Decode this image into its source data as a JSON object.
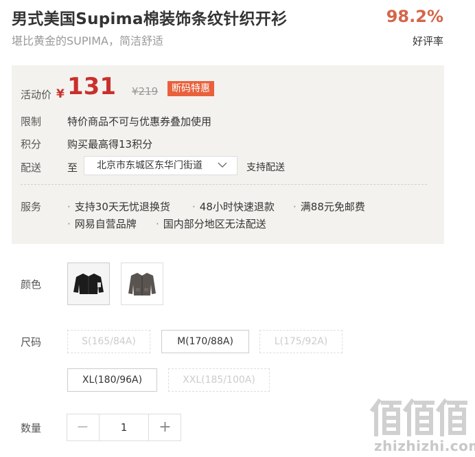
{
  "product": {
    "title": "男式美国Supima棉装饰条纹针织开衫",
    "subtitle": "堪比黄金的SUPIMA，简洁舒适",
    "rating_value": "98.2%",
    "rating_label": "好评率"
  },
  "price_panel": {
    "activity_label": "活动价",
    "currency": "¥",
    "price": "131",
    "original_price": "¥219",
    "badge": "断码特惠",
    "limit_label": "限制",
    "limit_text": "特价商品不可与优惠券叠加使用",
    "points_label": "积分",
    "points_text": "购买最高得13积分",
    "delivery_label": "配送",
    "delivery_to": "至",
    "address": "北京市东城区东华门街道",
    "delivery_support": "支持配送",
    "service_label": "服务",
    "services": [
      "支持30天无忧退换货",
      "48小时快速退款",
      "满88元免邮费",
      "网易自营品牌",
      "国内部分地区无法配送"
    ]
  },
  "color": {
    "label": "颜色",
    "options": [
      {
        "icon": "black-cardigan-thumbnail",
        "selected": true
      },
      {
        "icon": "gray-cardigan-thumbnail",
        "selected": false
      }
    ]
  },
  "size": {
    "label": "尺码",
    "options": [
      {
        "label": "S(165/84A)",
        "available": false
      },
      {
        "label": "M(170/88A)",
        "available": true
      },
      {
        "label": "L(175/92A)",
        "available": false
      },
      {
        "label": "XL(180/96A)",
        "available": true
      },
      {
        "label": "XXL(185/100A)",
        "available": false
      }
    ]
  },
  "quantity": {
    "label": "数量",
    "minus": "−",
    "value": "1",
    "plus": "+"
  },
  "watermark": {
    "logo_icon": "zhi-logo-icon",
    "text": "zhizhizhi.com"
  },
  "colors": {
    "accent": "#c9302c",
    "rating": "#d4664a",
    "badge": "#e8613c",
    "panel_bg": "#f3f2ef"
  }
}
